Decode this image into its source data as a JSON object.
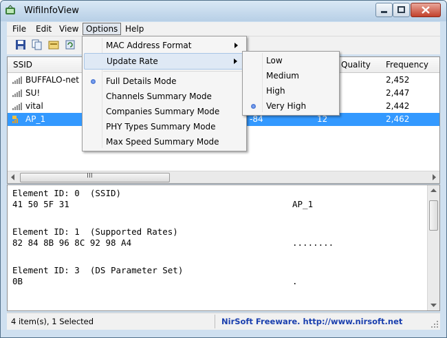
{
  "app": {
    "title": "WifiInfoView"
  },
  "menubar": {
    "items": [
      "File",
      "Edit",
      "View",
      "Options",
      "Help"
    ]
  },
  "list": {
    "columns": [
      "SSID",
      "Quality",
      "Frequency"
    ],
    "rows": [
      {
        "ssid": "BUFFALO-net",
        "signal": "",
        "quality": "",
        "frequency": "2,452"
      },
      {
        "ssid": "SU!",
        "signal": "",
        "quality": "",
        "frequency": "2,447"
      },
      {
        "ssid": "vital",
        "signal": "",
        "quality": "",
        "frequency": "2,442"
      },
      {
        "ssid": "AP_1",
        "signal": "-84",
        "quality": "12",
        "frequency": "2,462"
      }
    ],
    "scroll_glyph": "III"
  },
  "options_menu": {
    "items": [
      "MAC Address Format",
      "Update Rate",
      "Full Details Mode",
      "Channels Summary Mode",
      "Companies Summary Mode",
      "PHY Types Summary Mode",
      "Max Speed Summary Mode"
    ]
  },
  "update_rate_menu": {
    "items": [
      "Low",
      "Medium",
      "High",
      "Very High"
    ],
    "selected": "Very High"
  },
  "details": {
    "lines": [
      {
        "text": "Element ID: 0  (SSID)",
        "value": ""
      },
      {
        "text": "41 50 5F 31",
        "value": "AP_1"
      },
      {
        "text": "Element ID: 1  (Supported Rates)",
        "value": ""
      },
      {
        "text": "82 84 8B 96 8C 92 98 A4",
        "value": "........"
      },
      {
        "text": "Element ID: 3  (DS Parameter Set)",
        "value": ""
      },
      {
        "text": "0B",
        "value": "."
      }
    ]
  },
  "status": {
    "items_text": "4 item(s), 1 Selected",
    "credit_text": "NirSoft Freeware.  http://www.nirsoft.net"
  }
}
